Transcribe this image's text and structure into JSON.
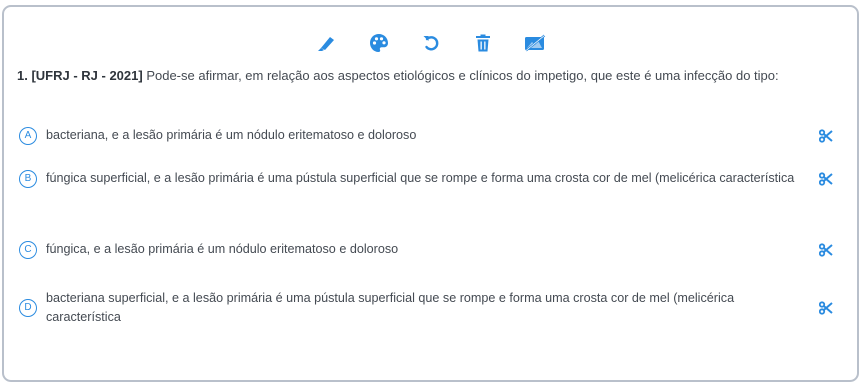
{
  "toolbar": {
    "icons": [
      "highlighter-icon",
      "palette-icon",
      "undo-icon",
      "trash-icon",
      "eraser-icon"
    ],
    "accent_color": "#2a8be0"
  },
  "question": {
    "source": "1. [UFRJ - RJ - 2021]",
    "text": " Pode-se afirmar, em relação aos aspectos etiológicos e clínicos do impetigo, que este é uma infecção do tipo:"
  },
  "options": [
    {
      "letter": "A",
      "text": "bacteriana, e a lesão primária é um nódulo eritematoso e doloroso"
    },
    {
      "letter": "B",
      "text": "fúngica superficial, e a lesão primária é uma pústula superficial que se rompe e forma uma crosta cor de mel (melicérica característica"
    },
    {
      "letter": "C",
      "text": "fúngica, e a lesão primária é um nódulo eritematoso e doloroso"
    },
    {
      "letter": "D",
      "text": "bacteriana superficial, e a lesão primária é uma pústula superficial que se rompe e forma uma crosta cor de mel (melicérica característica"
    }
  ]
}
